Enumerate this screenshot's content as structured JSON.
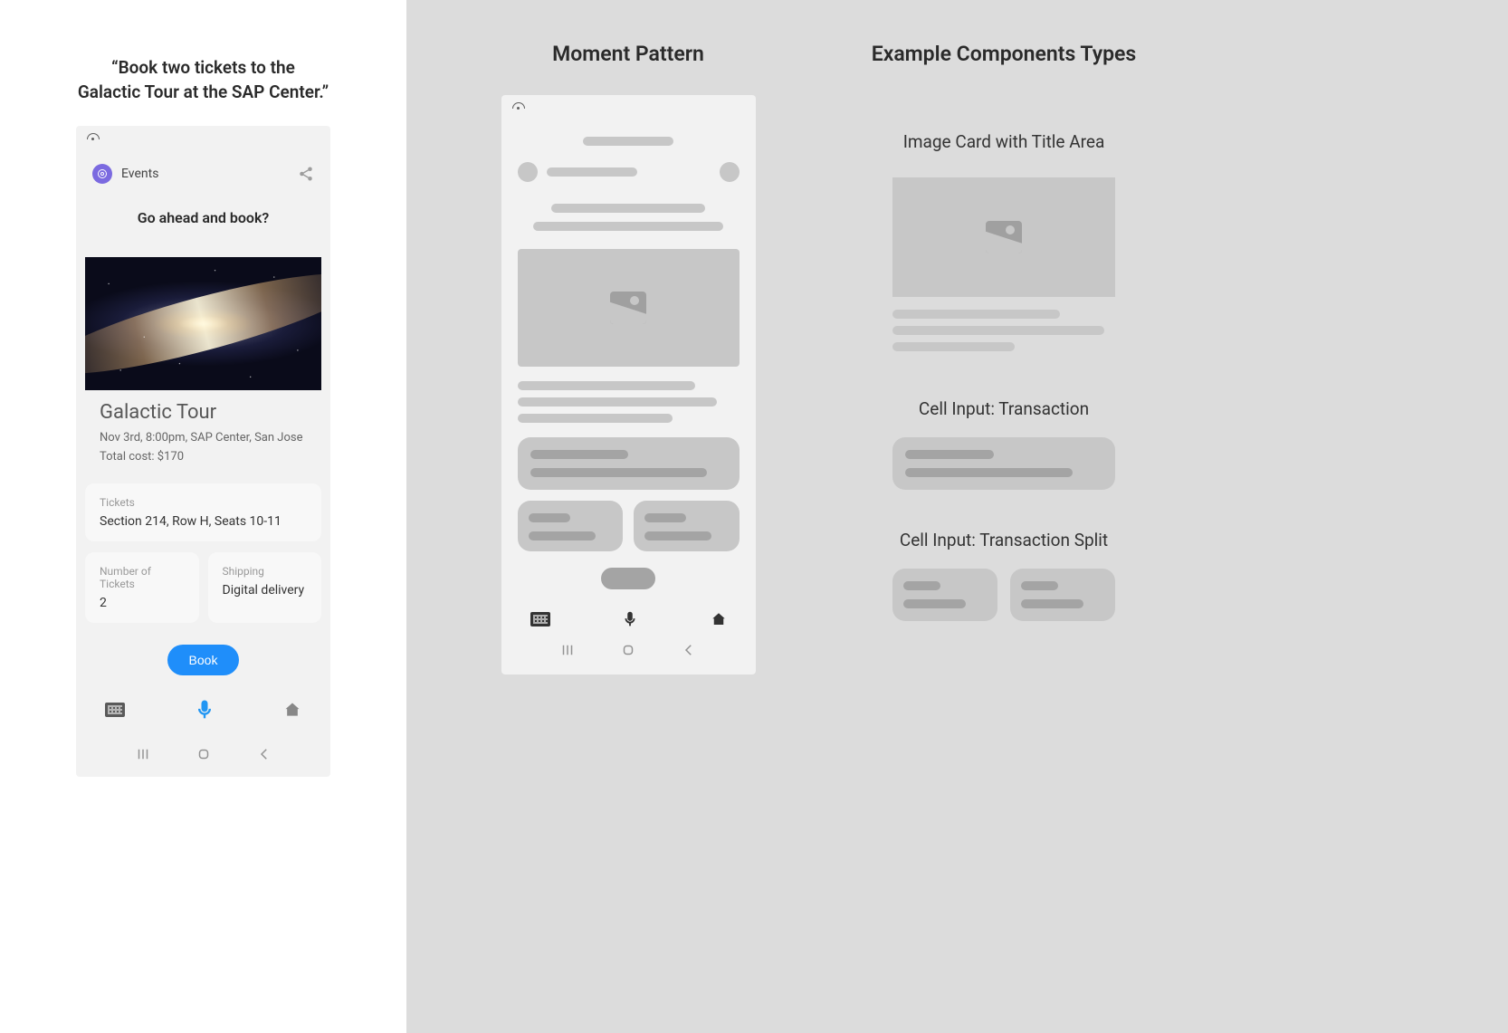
{
  "left": {
    "quote_line1": "“Book two tickets to the",
    "quote_line2": "Galactic Tour at the SAP Center.”",
    "header": {
      "category": "Events"
    },
    "prompt": "Go ahead and book?",
    "event": {
      "title": "Galactic Tour",
      "subtitle": "Nov 3rd, 8:00pm, SAP Center, San Jose",
      "cost": "Total cost: $170"
    },
    "tickets": {
      "label": "Tickets",
      "value": "Section 214, Row H, Seats 10-11"
    },
    "split": {
      "qty_label": "Number of Tickets",
      "qty_value": "2",
      "ship_label": "Shipping",
      "ship_value": "Digital delivery"
    },
    "book_btn": "Book"
  },
  "middle": {
    "title": "Moment Pattern"
  },
  "right": {
    "title": "Example Components Types",
    "h1": "Image Card with Title Area",
    "h2": "Cell Input: Transaction",
    "h3": "Cell Input: Transaction Split"
  }
}
